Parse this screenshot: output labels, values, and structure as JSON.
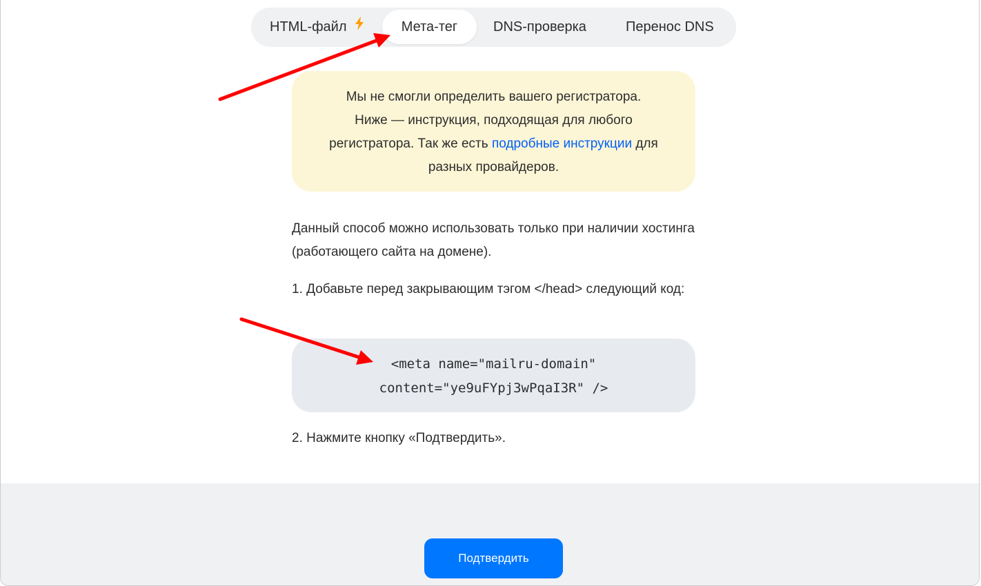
{
  "tabs": [
    {
      "label": "HTML-файл",
      "icon": "lightning-icon",
      "active": false
    },
    {
      "label": "Мета-тег",
      "active": true
    },
    {
      "label": "DNS-проверка",
      "active": false
    },
    {
      "label": "Перенос DNS",
      "active": false
    }
  ],
  "notice": {
    "line1": "Мы не смогли определить вашего регистратора.",
    "text_before_link": "Ниже — инструкция, подходящая для любого регистратора. Так же есть ",
    "link_text": "подробные инструкции",
    "text_after_link": " для разных провайдеров."
  },
  "main": {
    "note": "Данный способ можно использовать только при наличии хостинга (работающего сайта на домене).",
    "step1": "1. Добавьте перед закрывающим тэгом </head> следующий код:",
    "code_line1": "<meta name=\"mailru-domain\"",
    "code_line2": "content=\"ye9uFYpj3wPqaI3R\" />",
    "step2": "2. Нажмите кнопку «Подтвердить»."
  },
  "footer": {
    "confirm_label": "Подтвердить"
  },
  "colors": {
    "accent": "#0077ff",
    "link": "#005ff9",
    "notice_bg": "#fdf6d6",
    "code_bg": "#e7ebf0",
    "arrow": "#ff0000",
    "bolt": "#ff9e00"
  }
}
